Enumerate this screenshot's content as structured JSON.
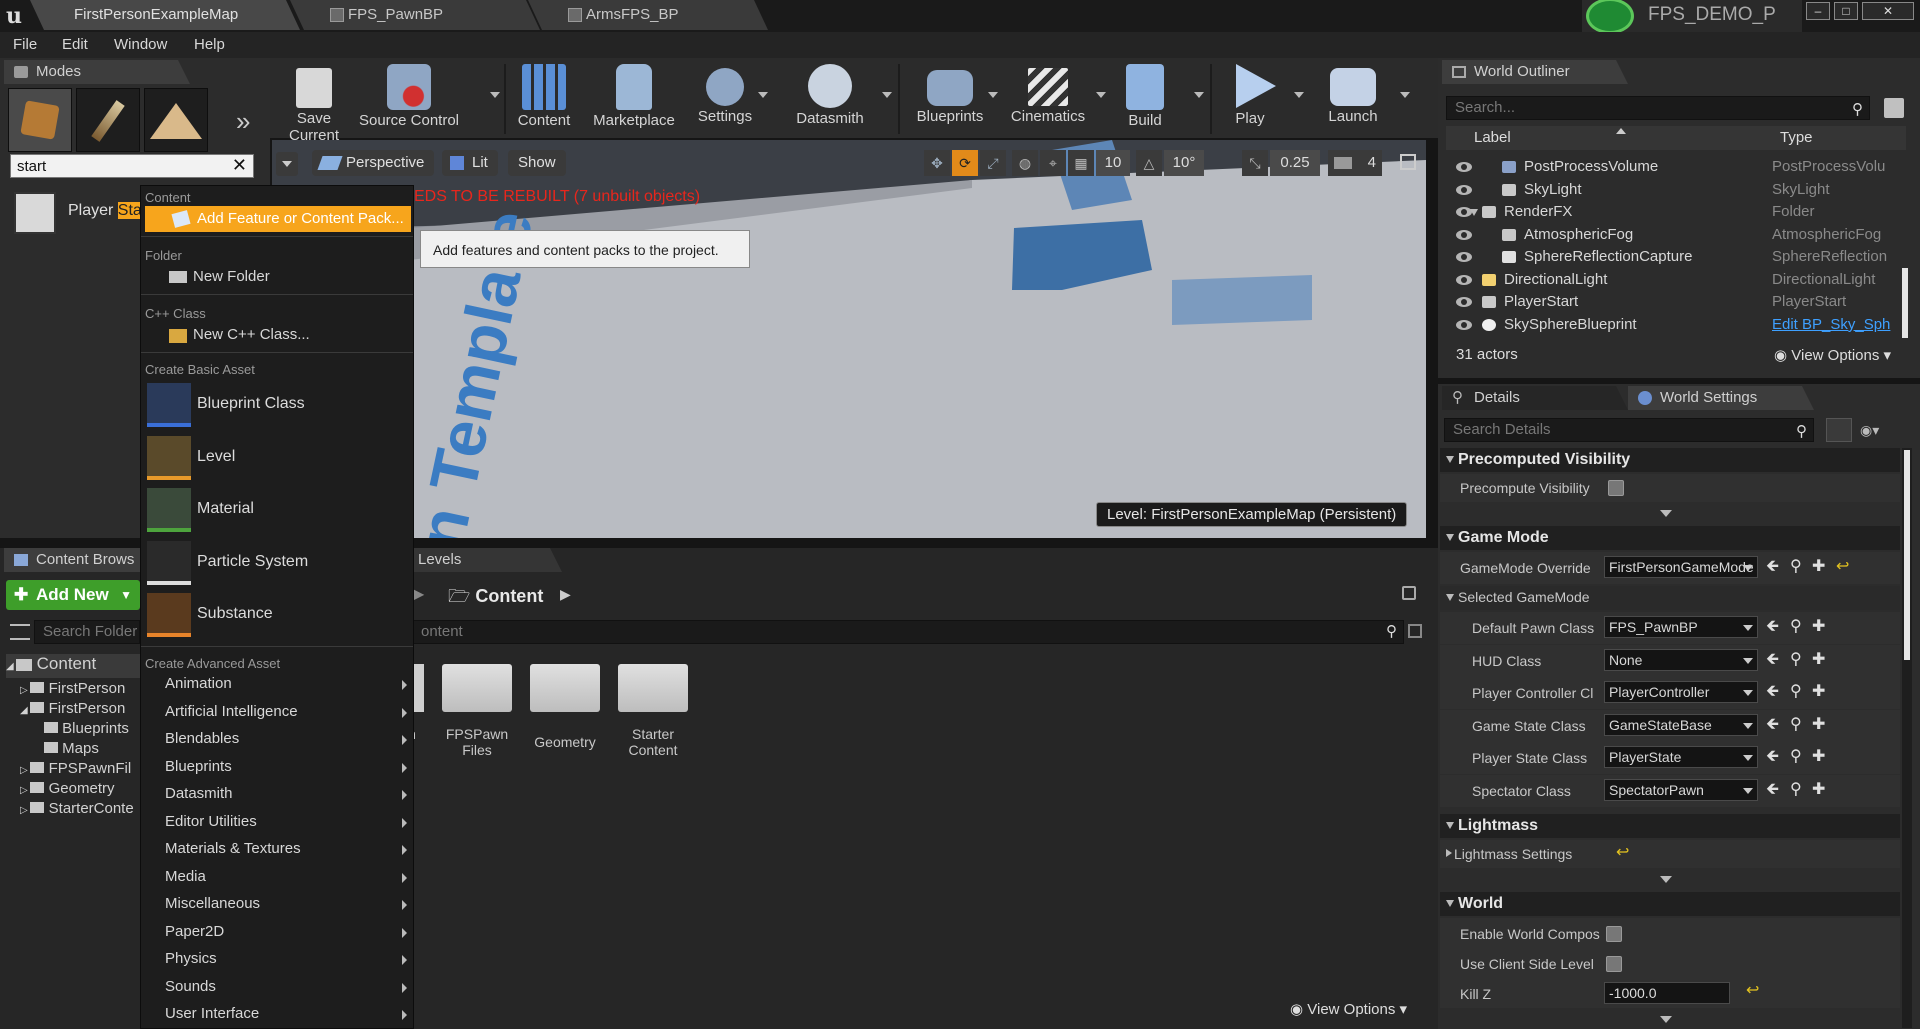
{
  "titlebar": {
    "tabs": [
      "FirstPersonExampleMap",
      "FPS_PawnBP",
      "ArmsFPS_BP"
    ],
    "project_name": "FPS_DEMO_P"
  },
  "menubar": {
    "items": [
      "File",
      "Edit",
      "Window",
      "Help"
    ]
  },
  "modes": {
    "tab_label": "Modes",
    "search_value": "start",
    "result_label": "Player Start",
    "result_highlight": "Sta"
  },
  "toolbar": {
    "buttons": [
      "Save Current",
      "Source Control",
      "Content",
      "Marketplace",
      "Settings",
      "Datasmith",
      "Blueprints",
      "Cinematics",
      "Build",
      "Play",
      "Launch"
    ]
  },
  "viewport": {
    "perspective": "Perspective",
    "lit": "Lit",
    "show": "Show",
    "grid_snap": "10",
    "rot_snap": "10°",
    "scale_snap": "0.25",
    "cam_speed": "4",
    "warning": "EDS TO BE REBUILT (7 unbuilt objects)",
    "floor_text": "n Template",
    "level_label": "Level:  FirstPersonExampleMap (Persistent)"
  },
  "outliner": {
    "tab_label": "World Outliner",
    "search_placeholder": "Search...",
    "col_label": "Label",
    "col_type": "Type",
    "rows": [
      {
        "label": "PostProcessVolume",
        "type": "PostProcessVolu"
      },
      {
        "label": "SkyLight",
        "type": "SkyLight"
      },
      {
        "label": "RenderFX",
        "type": "Folder"
      },
      {
        "label": "AtmosphericFog",
        "type": "AtmosphericFog"
      },
      {
        "label": "SphereReflectionCapture",
        "type": "SphereReflection"
      },
      {
        "label": "DirectionalLight",
        "type": "DirectionalLight"
      },
      {
        "label": "PlayerStart",
        "type": "PlayerStart"
      },
      {
        "label": "SkySphereBlueprint",
        "type": "Edit BP_Sky_Sph"
      }
    ],
    "actor_count": "31 actors",
    "view_options": "View Options"
  },
  "details": {
    "tab_details": "Details",
    "tab_world_settings": "World Settings",
    "search_placeholder": "Search Details",
    "precomputed_visibility": {
      "header": "Precomputed Visibility",
      "prop": "Precompute Visibility"
    },
    "game_mode": {
      "header": "Game Mode",
      "override_label": "GameMode Override",
      "override_value": "FirstPersonGameMode",
      "selected_label": "Selected GameMode",
      "props": [
        {
          "label": "Default Pawn Class",
          "value": "FPS_PawnBP"
        },
        {
          "label": "HUD Class",
          "value": "None"
        },
        {
          "label": "Player Controller Cl",
          "value": "PlayerController"
        },
        {
          "label": "Game State Class",
          "value": "GameStateBase"
        },
        {
          "label": "Player State Class",
          "value": "PlayerState"
        },
        {
          "label": "Spectator Class",
          "value": "SpectatorPawn"
        }
      ]
    },
    "lightmass": {
      "header": "Lightmass",
      "prop": "Lightmass Settings"
    },
    "world": {
      "header": "World",
      "enable_world_comp": "Enable World Compos",
      "use_client_side": "Use Client Side Level",
      "kill_z_label": "Kill Z",
      "kill_z_value": "-1000.0"
    }
  },
  "content_browser": {
    "tab_label": "Content Brows",
    "levels_tab": "Levels",
    "add_new": "Add New",
    "search_folders_placeholder": "Search Folder",
    "path": "Content",
    "search_assets_placeholder": "ontent",
    "tree": [
      "Content",
      "FirstPerson",
      "FirstPerson",
      "Blueprints",
      "Maps",
      "FPSPawnFil",
      "Geometry",
      "StarterConte"
    ],
    "folders": [
      {
        "name": "n",
        "name2": ""
      },
      {
        "name": "FPSPawn",
        "name2": "Files"
      },
      {
        "name": "Geometry",
        "name2": ""
      },
      {
        "name": "Starter",
        "name2": "Content"
      }
    ],
    "view_options": "View Options"
  },
  "dropdown": {
    "content_header": "Content",
    "add_feature": "Add Feature or Content Pack...",
    "folder_header": "Folder",
    "new_folder": "New Folder",
    "cpp_header": "C++ Class",
    "new_cpp": "New C++ Class...",
    "basic_header": "Create Basic Asset",
    "basic_items": [
      "Blueprint Class",
      "Level",
      "Material",
      "Particle System",
      "Substance"
    ],
    "advanced_header": "Create Advanced Asset",
    "advanced_items": [
      "Animation",
      "Artificial Intelligence",
      "Blendables",
      "Blueprints",
      "Datasmith",
      "Editor Utilities",
      "Materials & Textures",
      "Media",
      "Miscellaneous",
      "Paper2D",
      "Physics",
      "Sounds",
      "User Interface"
    ]
  },
  "tooltip": "Add features and content packs to the project.",
  "colors": {
    "accent_orange": "#f7a51c",
    "warning_red": "#e8261c",
    "add_new_green": "#3e9e2a",
    "link_blue": "#3ea0ff"
  }
}
